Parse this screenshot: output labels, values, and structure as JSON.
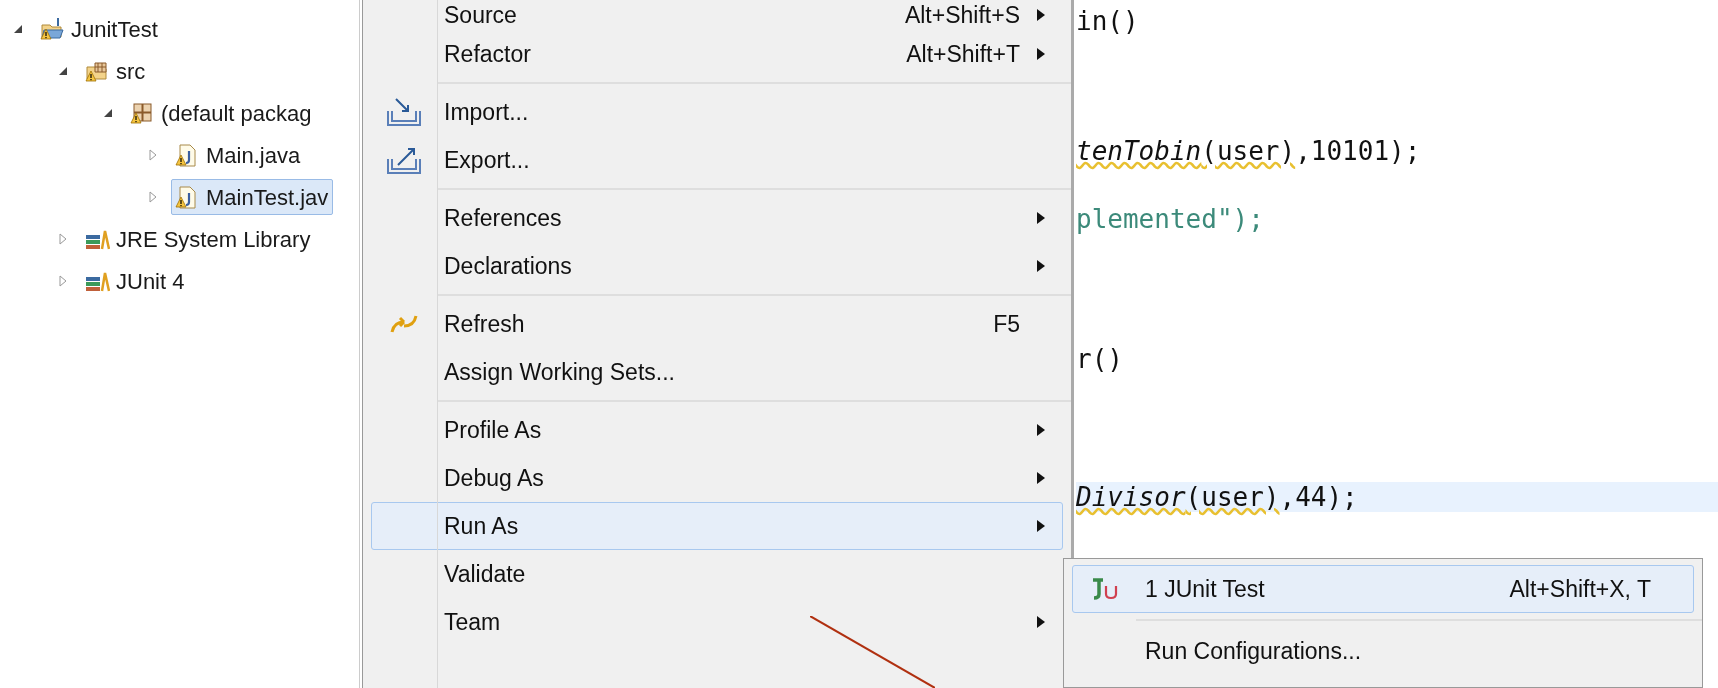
{
  "project_tree": [
    {
      "label": "JunitTest",
      "kind": "project",
      "expanded": true,
      "selected": false,
      "children": [
        {
          "label": "src",
          "kind": "source-folder",
          "expanded": true,
          "selected": false,
          "children": [
            {
              "label": "(default packag",
              "kind": "package",
              "expanded": true,
              "selected": false,
              "children": [
                {
                  "label": "Main.java",
                  "kind": "java-file",
                  "expanded": false,
                  "selected": false
                },
                {
                  "label": "MainTest.jav",
                  "kind": "java-file",
                  "expanded": false,
                  "selected": true
                }
              ]
            }
          ]
        },
        {
          "label": "JRE System Library",
          "kind": "library",
          "expanded": false,
          "selected": false
        },
        {
          "label": "JUnit 4",
          "kind": "library",
          "expanded": false,
          "selected": false
        }
      ]
    }
  ],
  "editor": {
    "lines": [
      {
        "current": false,
        "segments": [
          {
            "text": "in()",
            "kind": "plain",
            "warning": false
          }
        ]
      },
      {
        "current": false,
        "segments": [
          {
            "text": "tenTobin",
            "kind": "italic",
            "warning": true
          },
          {
            "text": "(user)",
            "kind": "plain",
            "warning": true
          },
          {
            "text": ",10101);",
            "kind": "plain",
            "warning": false
          }
        ]
      },
      {
        "current": false,
        "segments": [
          {
            "text": "plemented\");",
            "kind": "string",
            "warning": false
          }
        ]
      },
      {
        "current": false,
        "segments": [
          {
            "text": "r()",
            "kind": "plain",
            "warning": false
          }
        ]
      },
      {
        "current": true,
        "segments": [
          {
            "text": "Divisor",
            "kind": "italic",
            "warning": true
          },
          {
            "text": "(user)",
            "kind": "plain",
            "warning": true
          },
          {
            "text": ",44);",
            "kind": "plain",
            "warning": false
          }
        ]
      }
    ]
  },
  "context_menu": {
    "groups": [
      [
        {
          "label": "Source",
          "shortcut": "Alt+Shift+S",
          "submenu": true,
          "selected": false
        },
        {
          "label": "Refactor",
          "shortcut": "Alt+Shift+T",
          "submenu": true,
          "selected": false
        }
      ],
      [
        {
          "label": "Import...",
          "submenu": false,
          "kind": "import",
          "selected": false
        },
        {
          "label": "Export...",
          "submenu": false,
          "kind": "export",
          "selected": false
        }
      ],
      [
        {
          "label": "References",
          "submenu": true,
          "selected": false
        },
        {
          "label": "Declarations",
          "submenu": true,
          "selected": false
        }
      ],
      [
        {
          "label": "Refresh",
          "shortcut": "F5",
          "submenu": false,
          "kind": "refresh",
          "selected": false
        },
        {
          "label": "Assign Working Sets...",
          "submenu": false,
          "selected": false
        }
      ],
      [
        {
          "label": "Profile As",
          "submenu": true,
          "selected": false
        },
        {
          "label": "Debug As",
          "submenu": true,
          "selected": false
        },
        {
          "label": "Run As",
          "submenu": true,
          "selected": true
        },
        {
          "label": "Validate",
          "submenu": false,
          "selected": false
        },
        {
          "label": "Team",
          "submenu": true,
          "selected": false
        }
      ]
    ]
  },
  "run_as_submenu": {
    "groups": [
      [
        {
          "label": "1 JUnit Test",
          "shortcut": "Alt+Shift+X, T",
          "kind": "junit",
          "selected": true
        }
      ],
      [
        {
          "label": "Run Configurations...",
          "selected": false
        }
      ]
    ]
  }
}
